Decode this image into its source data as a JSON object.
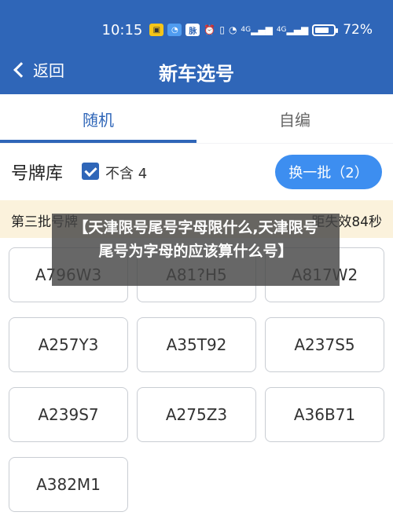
{
  "status_bar": {
    "time": "10:15",
    "battery": "72%",
    "network_1": "4G",
    "network_2": "4G",
    "wifi": "WiFi"
  },
  "nav": {
    "back_label": "返回",
    "title": "新车选号"
  },
  "tabs": [
    {
      "label": "随机",
      "active": true
    },
    {
      "label": "自编",
      "active": false
    }
  ],
  "library": {
    "title": "号牌库",
    "exclude_checked": true,
    "exclude_label": "不含 4",
    "refresh_button": "换一批（2）"
  },
  "batch": {
    "name": "第三批号牌",
    "timer": "距失效84秒"
  },
  "plates": [
    "A796W3",
    "A81?H5",
    "A817W2",
    "A257Y3",
    "A35T92",
    "A237S5",
    "A239S7",
    "A275Z3",
    "A36B71",
    "A382M1"
  ],
  "overlay": {
    "line1": "【天津限号尾号字母限什么,天津限号",
    "line2": "尾号为字母的应该算什么号】"
  },
  "colors": {
    "primary": "#2f66b8",
    "button": "#3d8ef0",
    "batch_bg": "#fbf2dc"
  }
}
